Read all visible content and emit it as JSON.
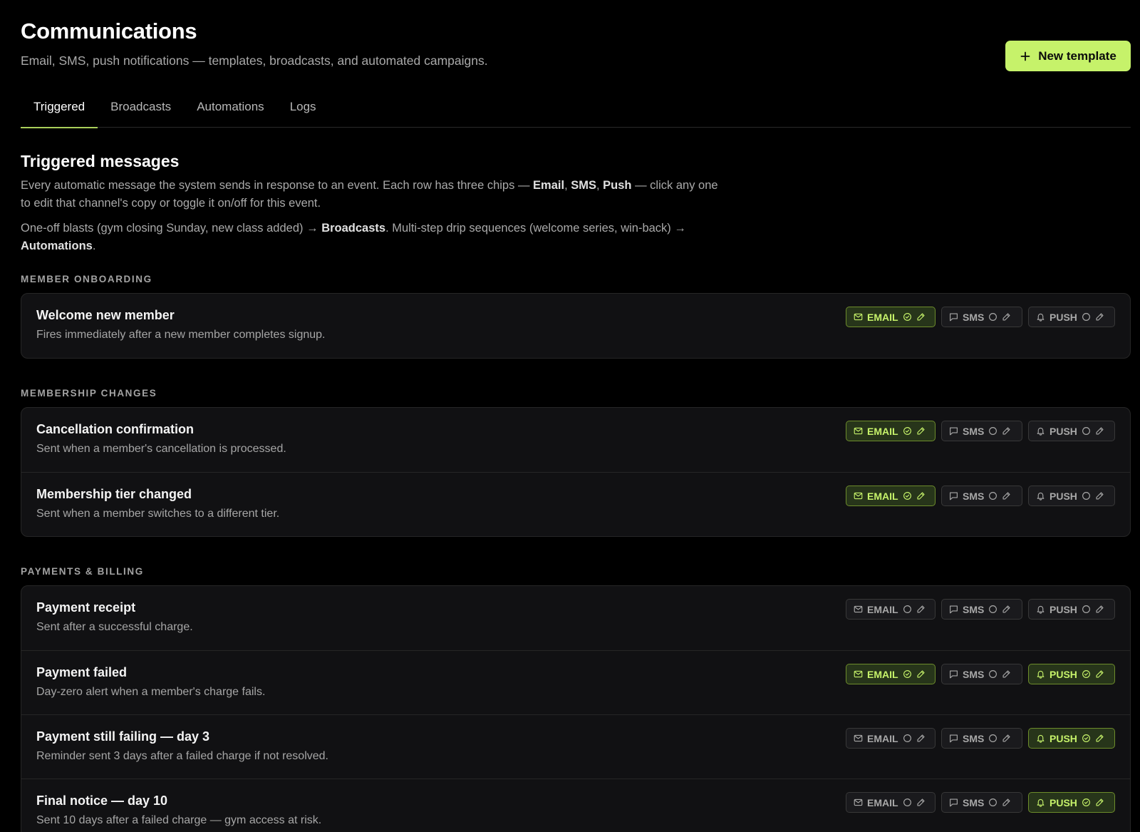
{
  "header": {
    "title": "Communications",
    "subtitle": "Email, SMS, push notifications — templates, broadcasts, and automated campaigns.",
    "new_button_label": "New template",
    "new_button_icon": "plus-icon",
    "accent": "#c6f26a"
  },
  "tabs": [
    {
      "label": "Triggered",
      "active": true
    },
    {
      "label": "Broadcasts",
      "active": false
    },
    {
      "label": "Automations",
      "active": false
    },
    {
      "label": "Logs",
      "active": false
    }
  ],
  "section": {
    "title": "Triggered messages",
    "desc1": {
      "a": "Every automatic message the system sends in response to an event. Each row has three chips — ",
      "b1": "Email",
      "c1": ", ",
      "b2": "SMS",
      "c2": ", ",
      "b3": "Push",
      "d": " — click any one to edit that channel's copy or toggle it on/off for this event."
    },
    "desc2": {
      "a": "One-off blasts (gym closing Sunday, new class added) → ",
      "b1": "Broadcasts",
      "c": ". Multi-step drip sequences (welcome series, win-back) → ",
      "b2": "Automations",
      "d": "."
    }
  },
  "chip_labels": {
    "email": "EMAIL",
    "sms": "SMS",
    "push": "PUSH"
  },
  "chip_icons": {
    "email": "mail-icon",
    "sms": "message-icon",
    "push": "bell-icon",
    "on": "check-circle-icon",
    "off": "circle-icon",
    "edit": "pencil-icon"
  },
  "groups": [
    {
      "label": "MEMBER ONBOARDING",
      "rows": [
        {
          "title": "Welcome new member",
          "desc": "Fires immediately after a new member completes signup.",
          "email": true,
          "sms": false,
          "push": false
        }
      ]
    },
    {
      "label": "MEMBERSHIP CHANGES",
      "rows": [
        {
          "title": "Cancellation confirmation",
          "desc": "Sent when a member's cancellation is processed.",
          "email": true,
          "sms": false,
          "push": false
        },
        {
          "title": "Membership tier changed",
          "desc": "Sent when a member switches to a different tier.",
          "email": true,
          "sms": false,
          "push": false
        }
      ]
    },
    {
      "label": "PAYMENTS & BILLING",
      "rows": [
        {
          "title": "Payment receipt",
          "desc": "Sent after a successful charge.",
          "email": false,
          "sms": false,
          "push": false
        },
        {
          "title": "Payment failed",
          "desc": "Day-zero alert when a member's charge fails.",
          "email": true,
          "sms": false,
          "push": true
        },
        {
          "title": "Payment still failing — day 3",
          "desc": "Reminder sent 3 days after a failed charge if not resolved.",
          "email": false,
          "sms": false,
          "push": true
        },
        {
          "title": "Final notice — day 10",
          "desc": "Sent 10 days after a failed charge — gym access at risk.",
          "email": false,
          "sms": false,
          "push": true
        }
      ]
    }
  ]
}
